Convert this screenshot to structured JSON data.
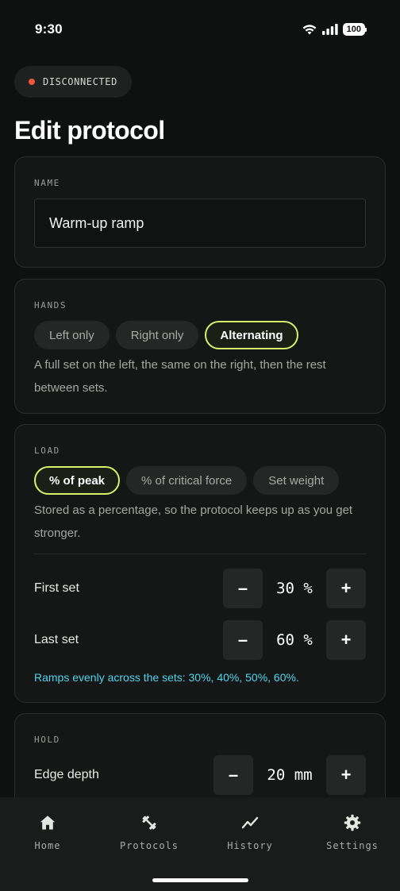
{
  "status_bar": {
    "time": "9:30",
    "battery": "100"
  },
  "connection": {
    "status": "DISCONNECTED"
  },
  "page": {
    "title": "Edit protocol"
  },
  "name_section": {
    "label": "NAME",
    "value": "Warm-up ramp"
  },
  "hands_section": {
    "label": "HANDS",
    "options": [
      "Left only",
      "Right only",
      "Alternating"
    ],
    "selected": "Alternating",
    "description": "A full set on the left, the same on the right, then the rest between sets."
  },
  "load_section": {
    "label": "LOAD",
    "options": [
      "% of peak",
      "% of critical force",
      "Set weight"
    ],
    "selected": "% of peak",
    "description": "Stored as a percentage, so the protocol keeps up as you get stronger.",
    "first_set": {
      "label": "First set",
      "value": "30 %"
    },
    "last_set": {
      "label": "Last set",
      "value": "60 %"
    },
    "ramp_note": "Ramps evenly across the sets: 30%, 40%, 50%, 60%."
  },
  "hold_section": {
    "label": "HOLD",
    "edge_depth": {
      "label": "Edge depth",
      "value": "20 mm"
    }
  },
  "stepper": {
    "minus": "–",
    "plus": "+"
  },
  "nav": {
    "items": [
      {
        "label": "Home",
        "icon": "home-icon"
      },
      {
        "label": "Protocols",
        "icon": "dumbbell-icon"
      },
      {
        "label": "History",
        "icon": "trend-line-icon"
      },
      {
        "label": "Settings",
        "icon": "gear-icon"
      }
    ]
  },
  "colors": {
    "accent": "#d8f06a",
    "info": "#4fd3ea",
    "danger": "#f1553d",
    "background": "#0f1110",
    "card": "#151716"
  }
}
